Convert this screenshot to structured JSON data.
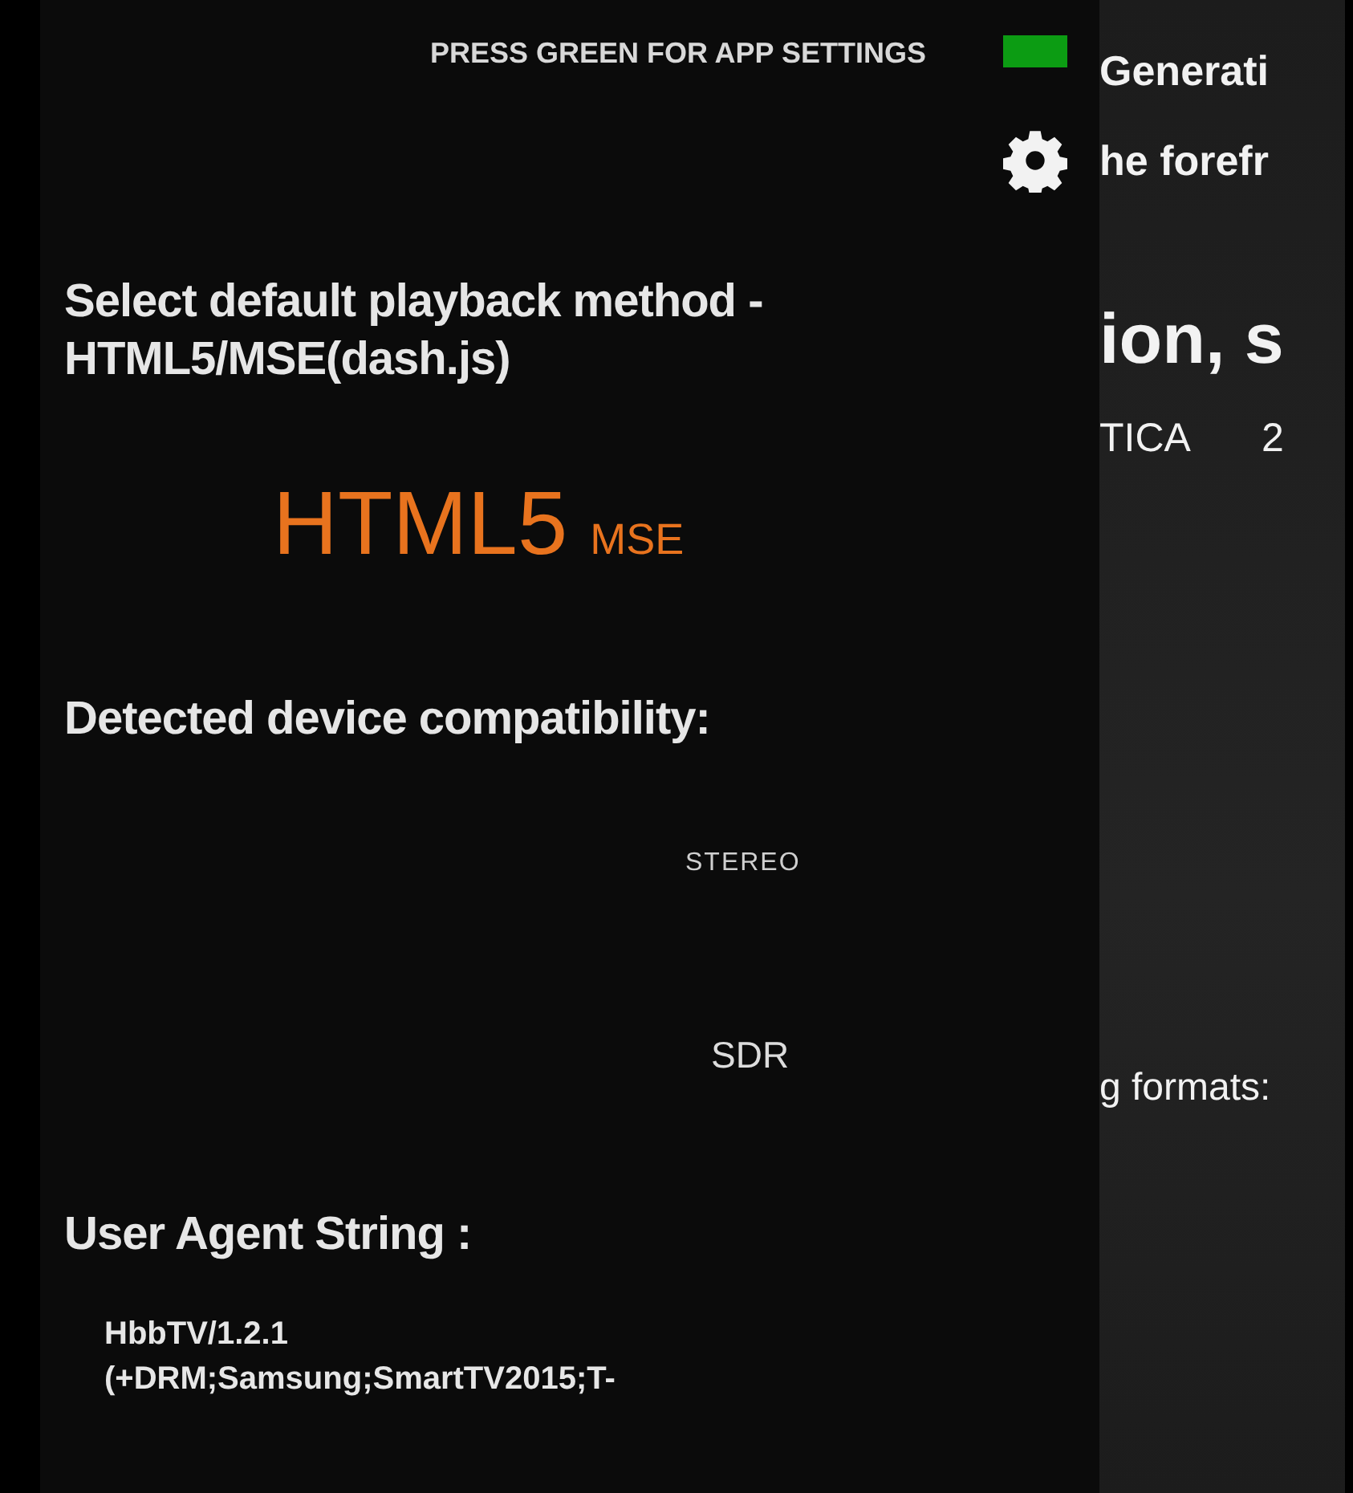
{
  "settings_panel": {
    "hint": "PRESS GREEN FOR APP SETTINGS",
    "playback": {
      "heading": "Select default playback method - HTML5/MSE(dash.js)",
      "method": "HTML5",
      "submethod": "MSE"
    },
    "compatibility": {
      "heading": "Detected device compatibility:",
      "audio": "STEREO",
      "video": "SDR"
    },
    "user_agent": {
      "heading": "User Agent String :",
      "lines": [
        "HbbTV/1.2.1",
        "(+DRM;Samsung;SmartTV2015;T-"
      ]
    }
  },
  "background_page": {
    "title_lines": [
      "Generati",
      "he forefr"
    ],
    "subtitle": "ion, s",
    "tags": [
      "TICA",
      "2"
    ],
    "formats_label": "g formats:"
  }
}
